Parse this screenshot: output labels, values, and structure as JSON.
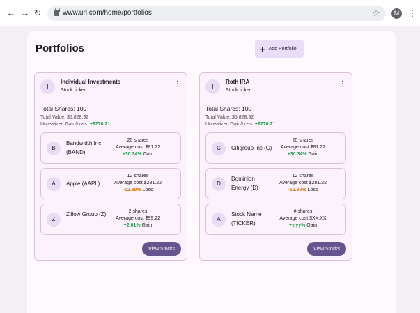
{
  "browser": {
    "url": "www.url.com/home/portfolios",
    "avatar_letter": "M"
  },
  "page": {
    "title": "Portfolios",
    "add_button_label": "Add Portfolio"
  },
  "portfolios": [
    {
      "avatar": "I",
      "name": "Individual Investments",
      "subtitle": "Stock ticker",
      "total_shares": "Total Shares: 100",
      "total_value": "Total Value: $5,828.92",
      "gain_label": "Unrealized Gain/Loss: ",
      "gain_value": "+$270.21",
      "view_button": "View Stocks",
      "stocks": [
        {
          "avatar": "B",
          "name": "Bandwidth Inc (BAND)",
          "shares": "20 shares",
          "avg": "Average cost $81.22",
          "pct": "+30.34%",
          "pct_label": " Gain",
          "direction": "up"
        },
        {
          "avatar": "A",
          "name": "Apple (AAPL)",
          "shares": "12 shares",
          "avg": "Average cost $281.22",
          "pct": "-12.89%",
          "pct_label": " Loss",
          "direction": "down"
        },
        {
          "avatar": "Z",
          "name": "Zillow Group (Z)",
          "shares": "2 shares",
          "avg": "Average cost $99.22",
          "pct": "+2.01%",
          "pct_label": " Gain",
          "direction": "up"
        }
      ]
    },
    {
      "avatar": "I",
      "name": "Roth IRA",
      "subtitle": "Stock ticker",
      "total_shares": "Total Shares: 100",
      "total_value": "Total Value: $5,828.92",
      "gain_label": "Unrealized Gain/Loss: ",
      "gain_value": "+$270.21",
      "view_button": "View Stocks",
      "stocks": [
        {
          "avatar": "C",
          "name": "Citigroup Inc (C)",
          "shares": "20 shares",
          "avg": "Average cost $81.22",
          "pct": "+30.34%",
          "pct_label": " Gain",
          "direction": "up"
        },
        {
          "avatar": "D",
          "name": "Dominion Energy (D)",
          "shares": "12 shares",
          "avg": "Average cost $281.22",
          "pct": "-12.89%",
          "pct_label": " Loss",
          "direction": "down"
        },
        {
          "avatar": "A",
          "name": "Stock Name (TICKER)",
          "shares": "# shares",
          "avg": "Average cost $XX.XX",
          "pct": "+y.yy%",
          "pct_label": " Gain",
          "direction": "up"
        }
      ]
    }
  ]
}
